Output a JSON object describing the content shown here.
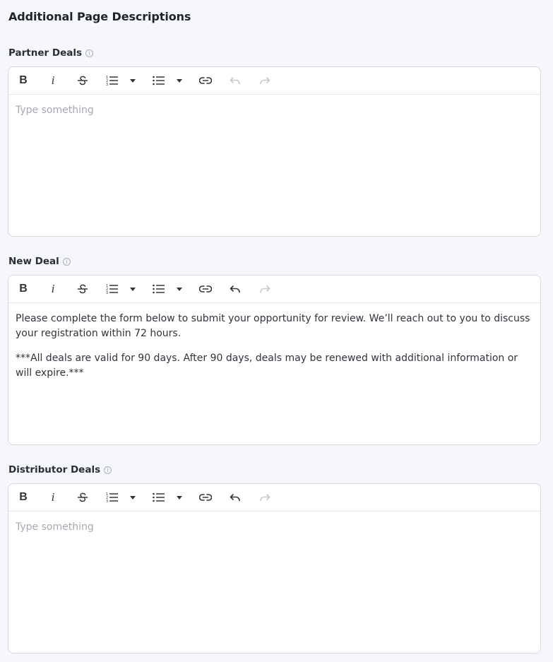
{
  "page_title": "Additional Page Descriptions",
  "toolbar": {
    "bold_label": "B",
    "italic_label": "i"
  },
  "sections": [
    {
      "label": "Partner Deals",
      "placeholder": "Type something",
      "paragraphs": [],
      "undo_enabled": false,
      "redo_enabled": false
    },
    {
      "label": "New Deal",
      "placeholder": "Type something",
      "paragraphs": [
        "Please complete the form below to submit your opportunity for review. We’ll reach out to you to discuss your registration within 72 hours.",
        "***All deals are valid for 90 days. After 90 days, deals may be renewed with additional information or will expire.***"
      ],
      "undo_enabled": true,
      "redo_enabled": false
    },
    {
      "label": "Distributor Deals",
      "placeholder": "Type something",
      "paragraphs": [],
      "undo_enabled": true,
      "redo_enabled": false
    }
  ],
  "colors": {
    "background": "#f6f7fa",
    "editor_border": "#d6dae0",
    "placeholder": "#a5aab2",
    "disabled_icon": "#c4c8ce"
  }
}
